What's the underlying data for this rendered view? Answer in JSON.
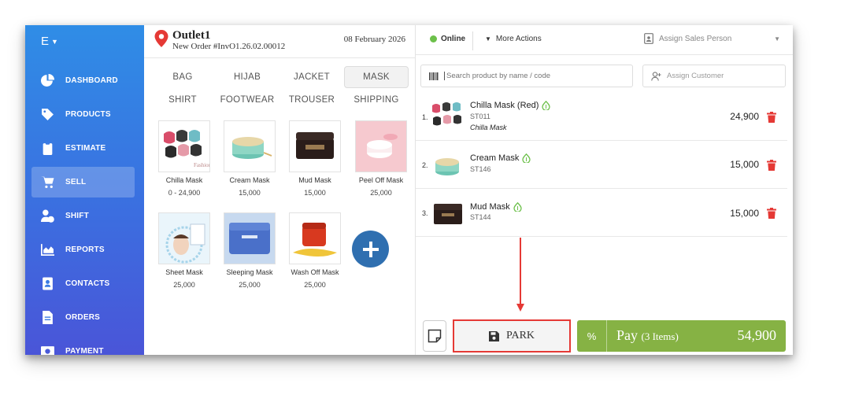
{
  "sidebar": {
    "brand": "E",
    "items": [
      {
        "label": "DASHBOARD",
        "icon": "pie-chart-icon"
      },
      {
        "label": "PRODUCTS",
        "icon": "tag-icon"
      },
      {
        "label": "ESTIMATE",
        "icon": "clipboard-icon"
      },
      {
        "label": "SELL",
        "icon": "cart-icon",
        "active": true
      },
      {
        "label": "SHIFT",
        "icon": "user-clock-icon"
      },
      {
        "label": "REPORTS",
        "icon": "area-chart-icon"
      },
      {
        "label": "CONTACTS",
        "icon": "address-book-icon"
      },
      {
        "label": "ORDERS",
        "icon": "file-icon"
      },
      {
        "label": "PAYMENT",
        "icon": "money-icon"
      }
    ]
  },
  "header": {
    "outlet": "Outlet1",
    "order_no": "New Order #InvO1.26.02.00012",
    "date": "08 February 2026"
  },
  "categories": [
    "BAG",
    "HIJAB",
    "JACKET",
    "MASK",
    "SHIRT",
    "FOOTWEAR",
    "TROUSER",
    "SHIPPING"
  ],
  "active_category": "MASK",
  "products": [
    {
      "name": "Chilla Mask",
      "price": "0 - 24,900"
    },
    {
      "name": "Cream Mask",
      "price": "15,000"
    },
    {
      "name": "Mud Mask",
      "price": "15,000"
    },
    {
      "name": "Peel Off Mask",
      "price": "25,000"
    },
    {
      "name": "Sheet Mask",
      "price": "25,000"
    },
    {
      "name": "Sleeping Mask",
      "price": "25,000"
    },
    {
      "name": "Wash Off Mask",
      "price": "25,000"
    }
  ],
  "topbar": {
    "status": "Online",
    "more_actions": "More Actions",
    "sales_person": "Assign Sales Person"
  },
  "search": {
    "placeholder": "Search product by name / code"
  },
  "assign_customer": "Assign Customer",
  "cart": [
    {
      "index": "1.",
      "name": "Chilla Mask (Red)",
      "sku": "ST011",
      "variant": "Chilla Mask",
      "price": "24,900"
    },
    {
      "index": "2.",
      "name": "Cream Mask",
      "sku": "ST146",
      "price": "15,000"
    },
    {
      "index": "3.",
      "name": "Mud Mask",
      "sku": "ST144",
      "price": "15,000"
    }
  ],
  "actions": {
    "park": "PARK",
    "discount": "%",
    "pay": "Pay",
    "pay_count": "(3 Items)",
    "total": "54,900"
  },
  "colors": {
    "sidebar_top": "#2f8de6",
    "sidebar_bottom": "#4a55d8",
    "pay_green": "#86b244",
    "highlight_red": "#e53935",
    "online_green": "#6cc04a"
  }
}
